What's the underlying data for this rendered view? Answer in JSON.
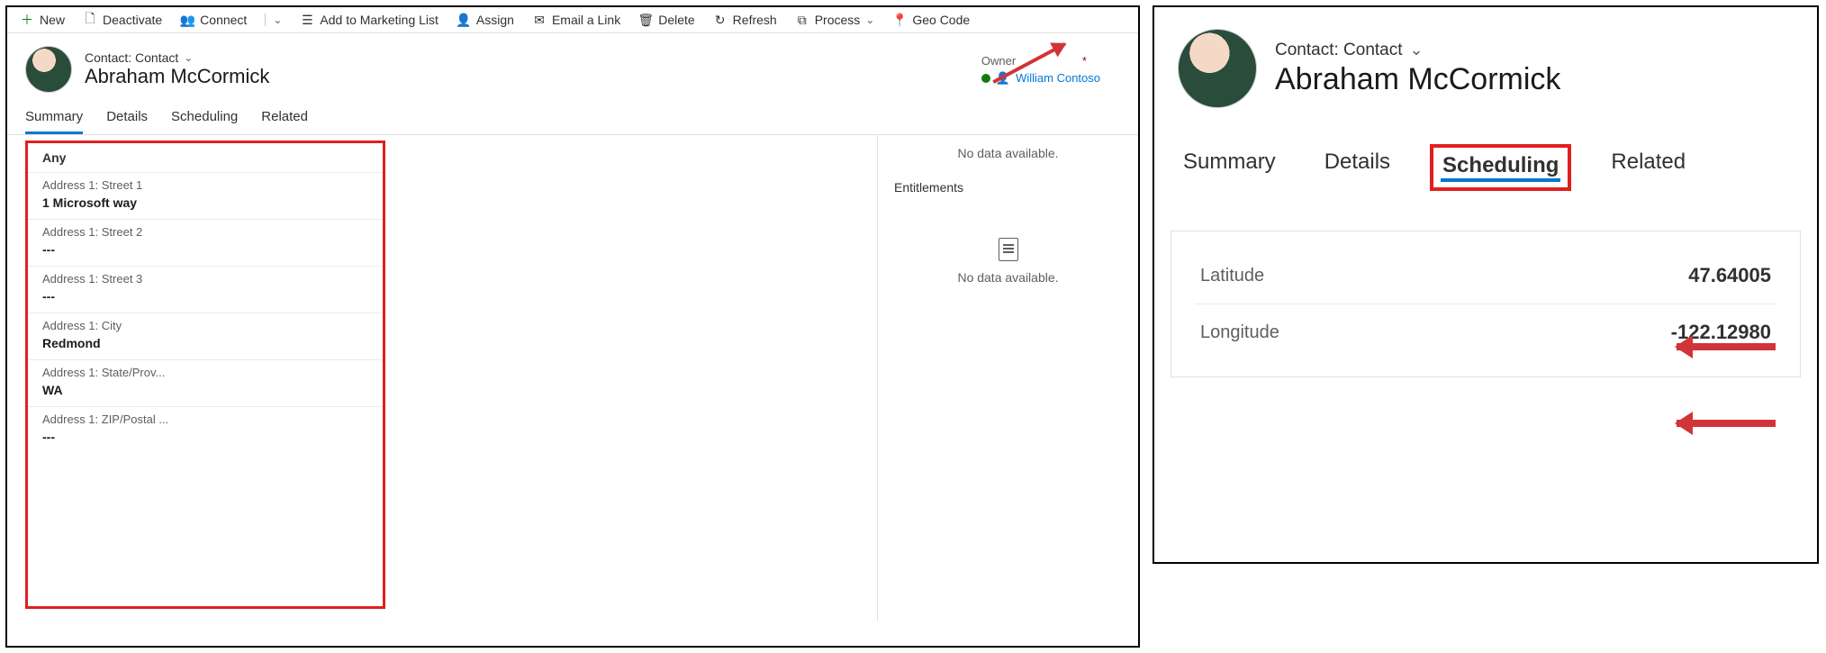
{
  "commands": {
    "new": "New",
    "deactivate": "Deactivate",
    "connect": "Connect",
    "add_marketing": "Add to Marketing List",
    "assign": "Assign",
    "email_link": "Email a Link",
    "delete": "Delete",
    "refresh": "Refresh",
    "process": "Process",
    "geocode": "Geo Code"
  },
  "header": {
    "entity_label": "Contact: Contact",
    "entity_name": "Abraham McCormick",
    "owner_label": "Owner",
    "owner_required": "*",
    "owner_value": "William Contoso"
  },
  "tabs_left": {
    "summary": "Summary",
    "details": "Details",
    "scheduling": "Scheduling",
    "related": "Related"
  },
  "address": {
    "section": "Any",
    "fields": [
      {
        "label": "Address 1: Street 1",
        "value": "1 Microsoft way"
      },
      {
        "label": "Address 1: Street 2",
        "value": "---"
      },
      {
        "label": "Address 1: Street 3",
        "value": "---"
      },
      {
        "label": "Address 1: City",
        "value": "Redmond"
      },
      {
        "label": "Address 1: State/Prov...",
        "value": "WA"
      },
      {
        "label": "Address 1: ZIP/Postal ...",
        "value": "---"
      }
    ]
  },
  "side": {
    "nodata1": "No data available.",
    "entitlements": "Entitlements",
    "nodata2": "No data available."
  },
  "right": {
    "entity_label": "Contact: Contact",
    "entity_name": "Abraham McCormick",
    "tabs": {
      "summary": "Summary",
      "details": "Details",
      "scheduling": "Scheduling",
      "related": "Related"
    },
    "coords": {
      "lat_label": "Latitude",
      "lat_value": "47.64005",
      "lon_label": "Longitude",
      "lon_value": "-122.12980"
    }
  }
}
